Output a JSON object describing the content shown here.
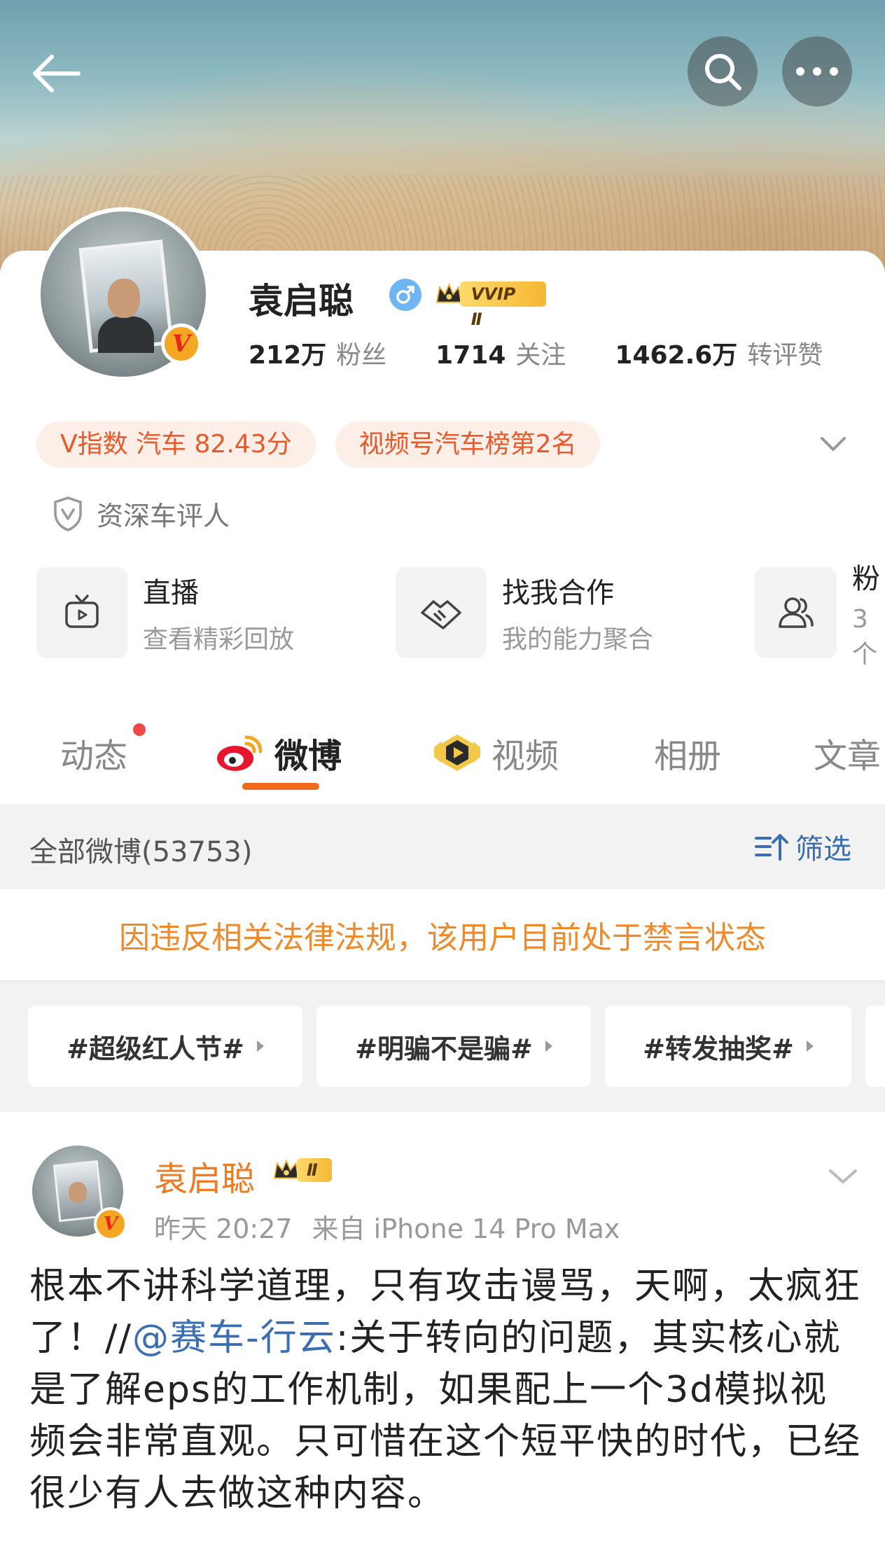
{
  "header": {
    "back_icon": "back-arrow-icon",
    "search_icon": "search-icon",
    "more_icon": "more-dots-icon"
  },
  "profile": {
    "name": "袁启聪",
    "vip_label": "VVIP Ⅱ",
    "stats": [
      {
        "num": "212万",
        "label": "粉丝"
      },
      {
        "num": "1714",
        "label": "关注"
      },
      {
        "num": "1462.6万",
        "label": "转评赞"
      }
    ],
    "pills": [
      "V指数 汽车 82.43分",
      "视频号汽车榜第2名"
    ],
    "certification": "资深车评人",
    "verified_badge": "V"
  },
  "quick_links": [
    {
      "title": "直播",
      "subtitle": "查看精彩回放",
      "icon": "tv-icon"
    },
    {
      "title": "找我合作",
      "subtitle": "我的能力聚合",
      "icon": "handshake-icon"
    },
    {
      "title": "粉",
      "subtitle": "3个",
      "icon": "group-icon"
    }
  ],
  "tabs": [
    {
      "label": "动态",
      "has_dot": true
    },
    {
      "label": "微博",
      "active": true
    },
    {
      "label": "视频"
    },
    {
      "label": "相册"
    },
    {
      "label": "文章"
    }
  ],
  "feed": {
    "count_label": "全部微博(53753)",
    "filter_label": "筛选",
    "ban_notice": "因违反相关法律法规，该用户目前处于禁言状态",
    "hashtags": [
      "#超级红人节#",
      "#明骗不是骗#",
      "#转发抽奖#"
    ]
  },
  "post": {
    "author": "袁启聪",
    "vip_label": "Ⅱ",
    "time": "昨天 20:27",
    "source": "来自 iPhone 14 Pro Max",
    "text_before": "根本不讲科学道理，只有攻击谩骂，天啊，太疯狂了！//",
    "mention": "@赛车-行云",
    "text_after": ":关于转向的问题，其实核心就是了解eps的工作机制，如果配上一个3d模拟视频会非常直观。只可惜在这个短平快的时代，已经很少有人去做这种内容。"
  },
  "colors": {
    "accent_orange": "#f06a1e",
    "link_blue": "#3b6db3",
    "pill_text": "#e85a2a"
  }
}
